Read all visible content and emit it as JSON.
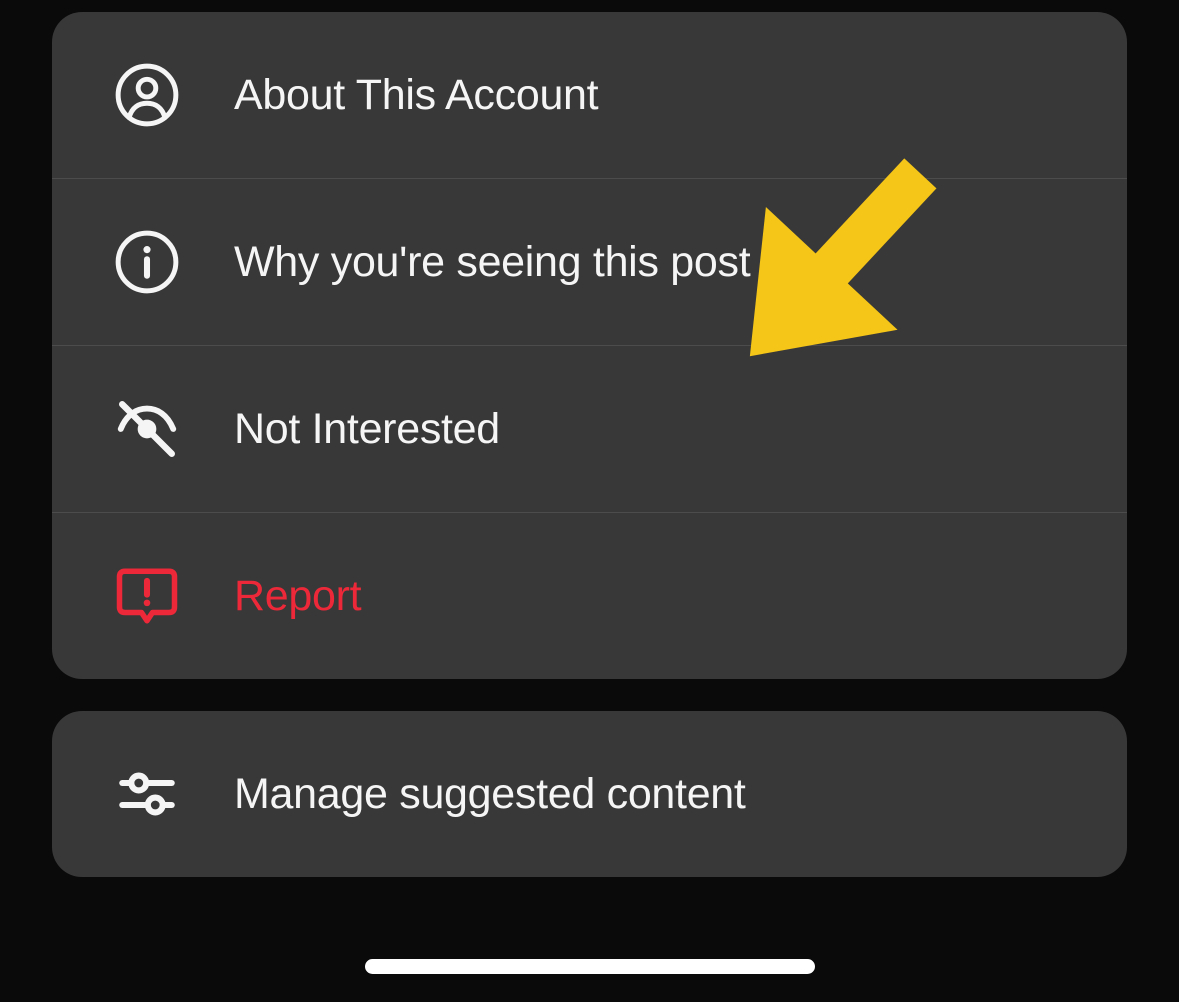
{
  "menu": {
    "group1": {
      "items": [
        {
          "label": "About This Account",
          "icon": "person-circle-icon"
        },
        {
          "label": "Why you're seeing this post",
          "icon": "info-icon"
        },
        {
          "label": "Not Interested",
          "icon": "eye-slash-icon"
        },
        {
          "label": "Report",
          "icon": "report-icon",
          "danger": true
        }
      ]
    },
    "group2": {
      "items": [
        {
          "label": "Manage suggested content",
          "icon": "sliders-icon"
        }
      ]
    }
  },
  "annotation": {
    "arrow_color": "#f5c518"
  }
}
